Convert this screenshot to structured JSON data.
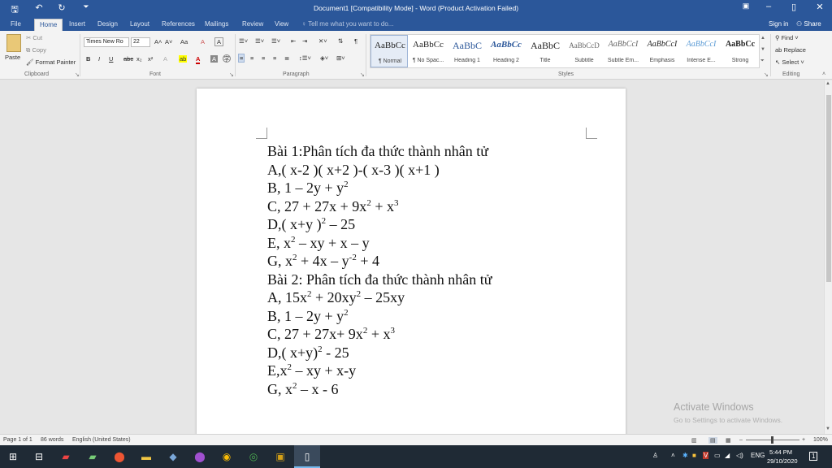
{
  "titlebar": {
    "title": "Document1 [Compatibility Mode] - Word (Product Activation Failed)",
    "save_icon": "save-icon",
    "undo_icon": "undo-icon",
    "redo_icon": "redo-icon",
    "customize_icon": "customize-qat-icon",
    "minimize": "–",
    "maximize": "▯",
    "close": "✕"
  },
  "tabs": [
    "File",
    "Home",
    "Insert",
    "Design",
    "Layout",
    "References",
    "Mailings",
    "Review",
    "View"
  ],
  "tellme": "Tell me what you want to do...",
  "signin": "Sign in",
  "share": "Share",
  "ribbon": {
    "clipboard": {
      "paste": "Paste",
      "cut": "Cut",
      "copy": "Copy",
      "format_painter": "Format Painter",
      "label": "Clipboard"
    },
    "font": {
      "font_name": "Times New Ro",
      "font_size": "22",
      "label": "Font",
      "bold": "B",
      "italic": "I",
      "underline": "U",
      "strike": "abc",
      "subscript": "x₂",
      "superscript": "x²",
      "grow": "A˄",
      "shrink": "A˅",
      "case": "Aa",
      "clear": "A",
      "highlight": "ab",
      "color": "A"
    },
    "paragraph": {
      "label": "Paragraph"
    },
    "styles": {
      "label": "Styles",
      "items": [
        {
          "preview": "AaBbCc",
          "name": "¶ Normal"
        },
        {
          "preview": "AaBbCc",
          "name": "¶ No Spac..."
        },
        {
          "preview": "AaBbC",
          "name": "Heading 1"
        },
        {
          "preview": "AaBbCc",
          "name": "Heading 2"
        },
        {
          "preview": "AaBbC",
          "name": "Title"
        },
        {
          "preview": "AaBbCcD",
          "name": "Subtitle"
        },
        {
          "preview": "AaBbCcI",
          "name": "Subtle Em..."
        },
        {
          "preview": "AaBbCcI",
          "name": "Emphasis"
        },
        {
          "preview": "AaBbCcI",
          "name": "Intense E..."
        },
        {
          "preview": "AaBbCc",
          "name": "Strong"
        }
      ]
    },
    "editing": {
      "find": "Find",
      "replace": "Replace",
      "select": "Select",
      "label": "Editing"
    }
  },
  "document": {
    "lines": [
      {
        "parts": [
          {
            "t": "Bài 1:Phân tích đa thức thành nhân tử"
          }
        ]
      },
      {
        "parts": [
          {
            "t": "A,( x-2 )( x+2 )-( x-3 )( x+1 )"
          }
        ]
      },
      {
        "parts": [
          {
            "t": "B, 1 – 2y + y"
          },
          {
            "sup": "2"
          }
        ]
      },
      {
        "parts": [
          {
            "t": "C, 27 + 27x + 9x"
          },
          {
            "sup": "2"
          },
          {
            "t": " + x"
          },
          {
            "sup": "3"
          }
        ]
      },
      {
        "parts": [
          {
            "t": "D,( x+y )"
          },
          {
            "sup": "2"
          },
          {
            "t": " – 25"
          }
        ]
      },
      {
        "parts": [
          {
            "t": "E, x"
          },
          {
            "sup": "2"
          },
          {
            "t": " – xy + x – y"
          }
        ]
      },
      {
        "parts": [
          {
            "t": "G, x"
          },
          {
            "sup": "2"
          },
          {
            "t": " + 4x – y"
          },
          {
            "sup": "-2"
          },
          {
            "t": " + 4"
          }
        ]
      },
      {
        "parts": [
          {
            "t": "Bài 2: Phân tích đa thức thành nhân tử"
          }
        ]
      },
      {
        "parts": [
          {
            "t": "A, 15x"
          },
          {
            "sup": "2"
          },
          {
            "t": " + 20xy"
          },
          {
            "sup": "2"
          },
          {
            "t": " – 25xy"
          }
        ]
      },
      {
        "parts": [
          {
            "t": "B,  1 – 2y + y"
          },
          {
            "sup": "2"
          }
        ]
      },
      {
        "parts": [
          {
            "t": "C, 27 + 27x+ 9x"
          },
          {
            "sup": "2"
          },
          {
            "t": " + x"
          },
          {
            "sup": "3"
          }
        ]
      },
      {
        "parts": [
          {
            "t": "D,( x+y)"
          },
          {
            "sup": "2"
          },
          {
            "t": " - 25"
          }
        ]
      },
      {
        "parts": [
          {
            "t": "E,x"
          },
          {
            "sup": "2"
          },
          {
            "t": " – xy + x-y"
          }
        ]
      },
      {
        "parts": [
          {
            "t": "G, x"
          },
          {
            "sup": "2"
          },
          {
            "t": " – x - 6"
          }
        ]
      }
    ]
  },
  "watermark": {
    "line1": "Activate Windows",
    "line2": "Go to Settings to activate Windows."
  },
  "statusbar": {
    "page": "Page 1 of 1",
    "words": "86 words",
    "language": "English (United States)",
    "zoom": "100%",
    "zoom_level_percent": 100
  },
  "taskbar": {
    "icons": [
      "windows-start-icon",
      "task-view-icon",
      "app-icon",
      "app-icon",
      "maps-icon",
      "file-explorer-icon",
      "app-icon",
      "app-icon",
      "chrome-icon",
      "app-icon",
      "app-icon",
      "word-document-icon"
    ],
    "language": "ENG",
    "time": "5:44 PM",
    "date": "29/10/2020"
  },
  "colors": {
    "word_blue": "#2b579a",
    "taskbar": "#1f2a35"
  }
}
